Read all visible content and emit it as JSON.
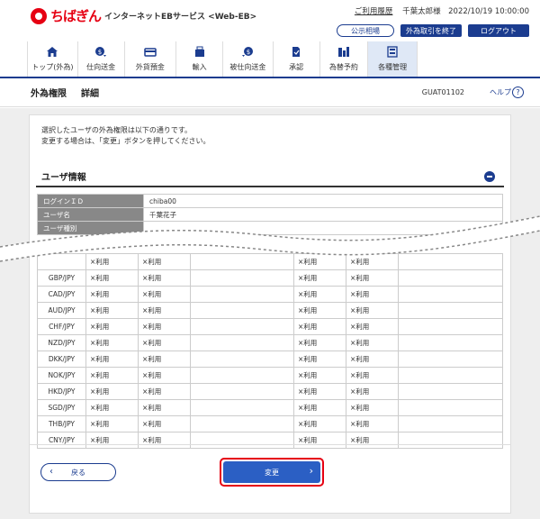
{
  "header": {
    "logo_text": "ちばぎん",
    "service_name": "インターネットEBサービス <Web-EB>",
    "usage_link": "ご利用履歴",
    "user_info": "千葉太郎様　2022/10/19 10:00:00",
    "rate_btn": "公示相場",
    "end_fx_btn": "外為取引を終了",
    "logout_btn": "ログアウト"
  },
  "nav": {
    "items": [
      {
        "label": "トップ(外為)"
      },
      {
        "label": "仕向送金"
      },
      {
        "label": "外貨預金"
      },
      {
        "label": "輸入"
      },
      {
        "label": "被仕向送金"
      },
      {
        "label": "承認"
      },
      {
        "label": "為替予約"
      },
      {
        "label": "各種管理"
      }
    ]
  },
  "subhead": {
    "title": "外為権限",
    "subtitle": "詳細",
    "screen_code": "GUAT01102",
    "help": "ヘルプ"
  },
  "instructions": {
    "line1": "選択したユーザの外為権限は以下の通りです。",
    "line2": "変更する場合は、「変更」ボタンを押してください。"
  },
  "section": {
    "title": "ユーザ情報"
  },
  "user_info": [
    {
      "key": "ログインＩＤ",
      "value": "chiba00"
    },
    {
      "key": "ユーザ名",
      "value": "千葉花子"
    },
    {
      "key": "ユーザ種別",
      "value": ""
    }
  ],
  "fx_rows": [
    {
      "pair": "",
      "c1": "×利用",
      "c2": "×利用",
      "c4": "×利用",
      "c5": "×利用"
    },
    {
      "pair": "GBP/JPY",
      "c1": "×利用",
      "c2": "×利用",
      "c4": "×利用",
      "c5": "×利用"
    },
    {
      "pair": "CAD/JPY",
      "c1": "×利用",
      "c2": "×利用",
      "c4": "×利用",
      "c5": "×利用"
    },
    {
      "pair": "AUD/JPY",
      "c1": "×利用",
      "c2": "×利用",
      "c4": "×利用",
      "c5": "×利用"
    },
    {
      "pair": "CHF/JPY",
      "c1": "×利用",
      "c2": "×利用",
      "c4": "×利用",
      "c5": "×利用"
    },
    {
      "pair": "NZD/JPY",
      "c1": "×利用",
      "c2": "×利用",
      "c4": "×利用",
      "c5": "×利用"
    },
    {
      "pair": "DKK/JPY",
      "c1": "×利用",
      "c2": "×利用",
      "c4": "×利用",
      "c5": "×利用"
    },
    {
      "pair": "NOK/JPY",
      "c1": "×利用",
      "c2": "×利用",
      "c4": "×利用",
      "c5": "×利用"
    },
    {
      "pair": "HKD/JPY",
      "c1": "×利用",
      "c2": "×利用",
      "c4": "×利用",
      "c5": "×利用"
    },
    {
      "pair": "SGD/JPY",
      "c1": "×利用",
      "c2": "×利用",
      "c4": "×利用",
      "c5": "×利用"
    },
    {
      "pair": "THB/JPY",
      "c1": "×利用",
      "c2": "×利用",
      "c4": "×利用",
      "c5": "×利用"
    },
    {
      "pair": "CNY/JPY",
      "c1": "×利用",
      "c2": "×利用",
      "c4": "×利用",
      "c5": "×利用"
    }
  ],
  "footer": {
    "back": "戻る",
    "change": "変更"
  }
}
